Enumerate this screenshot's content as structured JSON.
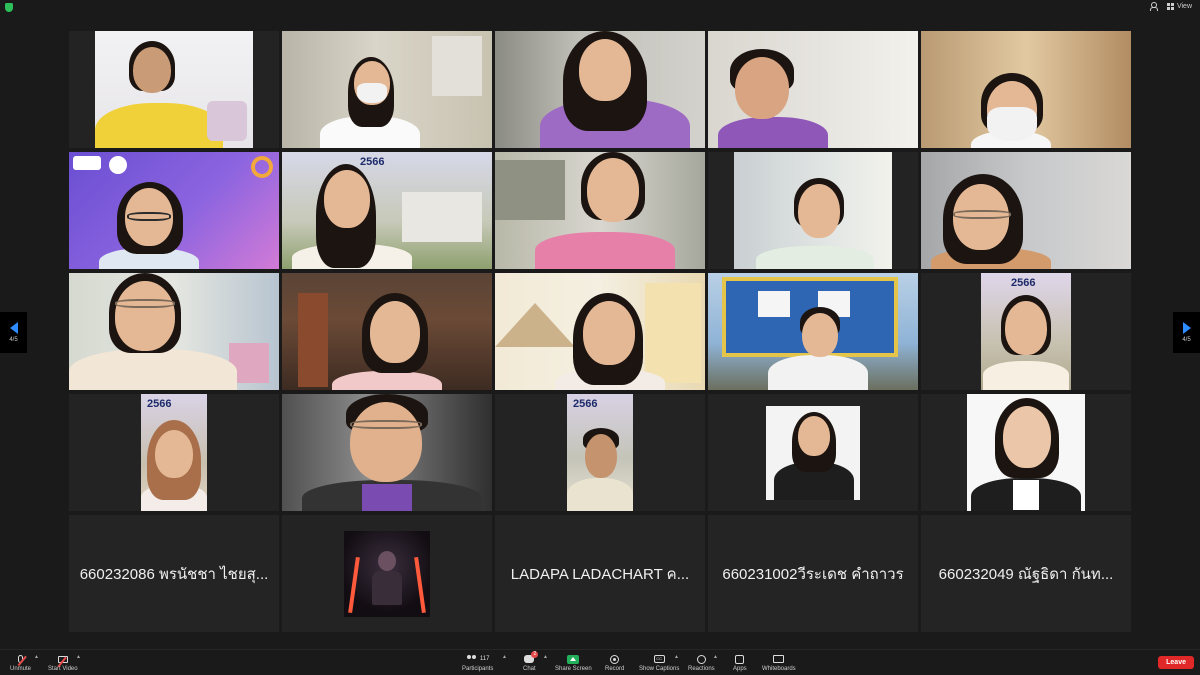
{
  "topbar": {
    "view_label": "View",
    "shield_icon": "green-shield-icon",
    "participant_icon": "person-icon"
  },
  "pager": {
    "left_label": "4/5",
    "right_label": "4/5"
  },
  "named_tiles": [
    "660232086 พรนัชชา ไชยสุ...",
    "LADAPA LADACHART ค...",
    "660231002วีระเดช คำถาวร",
    "660232049 ณัฐธิดา กันท..."
  ],
  "posters": {
    "year": "2566"
  },
  "toolbar": {
    "unmute": "Unmute",
    "start_video": "Start Video",
    "participants": "Participants",
    "participant_count": "117",
    "chat": "Chat",
    "chat_badge": "2",
    "share_screen": "Share Screen",
    "record": "Record",
    "show_captions": "Show Captions",
    "captions_icon_text": "CC",
    "reactions": "Reactions",
    "apps": "Apps",
    "whiteboards": "Whiteboards",
    "leave": "Leave"
  },
  "colors": {
    "background": "#1a1a1a",
    "tile": "#232323",
    "accent_blue": "#2d8cff",
    "share_green": "#23b05b",
    "leave_red": "#e02828"
  }
}
